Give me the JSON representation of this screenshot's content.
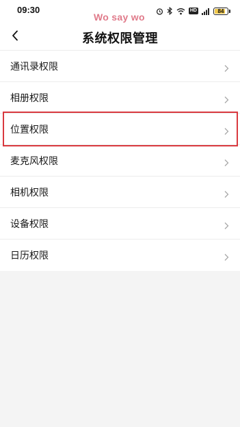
{
  "status_bar": {
    "time": "09:30",
    "watermark": "Wo say wo",
    "hd_label": "HD",
    "battery_level": "84",
    "battery_fraction": 0.84,
    "battery_color": "#f2c94c"
  },
  "header": {
    "title": "系统权限管理",
    "back_icon": "chevron-left-icon"
  },
  "permissions": {
    "items": [
      {
        "label": "通讯录权限"
      },
      {
        "label": "相册权限"
      },
      {
        "label": "位置权限"
      },
      {
        "label": "麦克风权限"
      },
      {
        "label": "相机权限"
      },
      {
        "label": "设备权限"
      },
      {
        "label": "日历权限"
      }
    ],
    "highlighted_item": "位置权限",
    "highlight_color": "#d9383e"
  }
}
